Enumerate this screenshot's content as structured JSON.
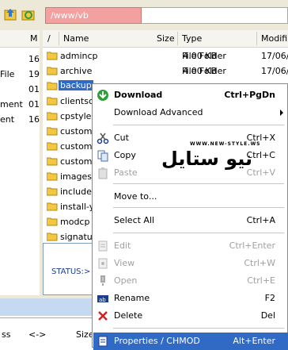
{
  "toolbar": {
    "path_value": "/www/vb"
  },
  "left_pane": {
    "header_label": "M",
    "rows": [
      {
        "label": "",
        "value": "16"
      },
      {
        "label": "File",
        "value": "19"
      },
      {
        "label": "",
        "value": "01"
      },
      {
        "label": "ment",
        "value": "01"
      },
      {
        "label": "ent",
        "value": "16"
      }
    ]
  },
  "file_list": {
    "columns": {
      "sort": "/",
      "name": "Name",
      "size": "Size",
      "type": "Type",
      "modified": "Modifi"
    },
    "rows": [
      {
        "name": "admincp",
        "size": "4.00 KB",
        "type": "File Folder",
        "modified": "17/06/"
      },
      {
        "name": "archive",
        "size": "4.00 KB",
        "type": "File Folder",
        "modified": "17/06/"
      },
      {
        "name": "backup",
        "size": "",
        "type": "",
        "modified": ""
      },
      {
        "name": "clientsc",
        "size": "",
        "type": "",
        "modified": ""
      },
      {
        "name": "cpstyles",
        "size": "",
        "type": "",
        "modified": ""
      },
      {
        "name": "custom",
        "size": "",
        "type": "",
        "modified": ""
      },
      {
        "name": "custom",
        "size": "",
        "type": "",
        "modified": ""
      },
      {
        "name": "custom",
        "size": "",
        "type": "",
        "modified": ""
      },
      {
        "name": "images",
        "size": "",
        "type": "",
        "modified": ""
      },
      {
        "name": "include",
        "size": "",
        "type": "",
        "modified": ""
      },
      {
        "name": "install-y",
        "size": "",
        "type": "",
        "modified": ""
      },
      {
        "name": "modcp",
        "size": "",
        "type": "",
        "modified": ""
      },
      {
        "name": "signatu",
        "size": "",
        "type": "",
        "modified": ""
      }
    ]
  },
  "status": {
    "label": "STATUS:>"
  },
  "bottom_header": {
    "col1": "ss",
    "col2": "<->",
    "col3": "Size"
  },
  "context_menu": {
    "items": [
      {
        "label": "Download",
        "shortcut": "Ctrl+PgDn",
        "icon": "download-icon",
        "enabled": true
      },
      {
        "label": "Download Advanced",
        "shortcut": "",
        "icon": "",
        "enabled": true
      },
      {
        "label": "Cut",
        "shortcut": "Ctrl+X",
        "icon": "scissors-icon",
        "enabled": true
      },
      {
        "label": "Copy",
        "shortcut": "Ctrl+C",
        "icon": "copy-icon",
        "enabled": true
      },
      {
        "label": "Paste",
        "shortcut": "Ctrl+V",
        "icon": "paste-icon",
        "enabled": false
      },
      {
        "label": "Move to...",
        "shortcut": "",
        "icon": "",
        "enabled": true
      },
      {
        "label": "Select All",
        "shortcut": "Ctrl+A",
        "icon": "",
        "enabled": true
      },
      {
        "label": "Edit",
        "shortcut": "Ctrl+Enter",
        "icon": "edit-icon",
        "enabled": false
      },
      {
        "label": "View",
        "shortcut": "Ctrl+W",
        "icon": "view-icon",
        "enabled": false
      },
      {
        "label": "Open",
        "shortcut": "Ctrl+E",
        "icon": "open-icon",
        "enabled": false
      },
      {
        "label": "Rename",
        "shortcut": "F2",
        "icon": "rename-icon",
        "enabled": true
      },
      {
        "label": "Delete",
        "shortcut": "Del",
        "icon": "delete-icon",
        "enabled": true
      },
      {
        "label": "Properties / CHMOD",
        "shortcut": "Alt+Enter",
        "icon": "properties-icon",
        "enabled": true
      }
    ]
  },
  "watermark": {
    "small": "WWW.NEW-STYLE.WS",
    "big": "نيو ستايل"
  },
  "colors": {
    "selection": "#316ac5",
    "path_highlight": "#f3a0a0",
    "download_green": "#2e9e3a",
    "delete_red": "#d42020"
  }
}
